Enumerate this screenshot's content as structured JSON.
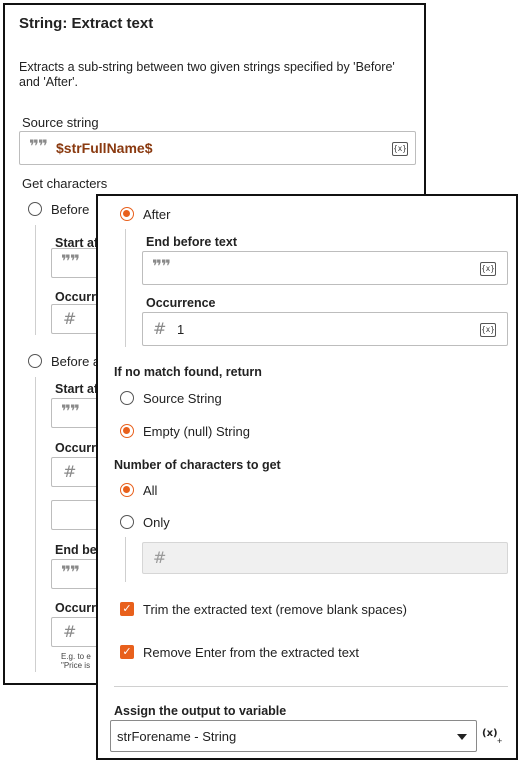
{
  "back": {
    "title": "String: Extract text",
    "description_line1": "Extracts a sub-string between two given strings specified by 'Before'",
    "description_line2": "and 'After'.",
    "source_label": "Source string",
    "source_value": "$strFullName$",
    "get_chars_label": "Get characters",
    "before_option": "Before",
    "start_after_label1": "Start af",
    "occurrence_label1": "Occurre",
    "before_and_option": "Before a",
    "start_after_label2": "Start af",
    "occurrence_label2": "Occurr",
    "end_before_label": "End be",
    "occurrence_label3": "Occurr",
    "hint_line1": "E.g. to e",
    "hint_line2": "\"Price is"
  },
  "front": {
    "after_option": "After",
    "end_before_text_label": "End before text",
    "end_before_text_value": "",
    "occurrence_label": "Occurrence",
    "occurrence_value": "1",
    "no_match_label": "If no match found, return",
    "no_match_options": [
      "Source String",
      "Empty (null) String"
    ],
    "no_match_selected": "Empty (null) String",
    "num_chars_label": "Number of characters to get",
    "num_chars_options": [
      "All",
      "Only"
    ],
    "num_chars_selected": "All",
    "only_value": "",
    "trim_label": "Trim the extracted text (remove blank spaces)",
    "trim_checked": true,
    "remove_enter_label": "Remove Enter from the extracted text",
    "remove_enter_checked": true,
    "assign_label": "Assign the output to variable",
    "assign_value": "strForename - String",
    "var_button": "(x)"
  },
  "colors": {
    "accent": "#e8601c",
    "border": "#111111"
  },
  "icons": {
    "quote": "quote-icon",
    "hash": "hash-icon",
    "variable": "variable-icon",
    "dropdown": "chevron-down-icon"
  }
}
